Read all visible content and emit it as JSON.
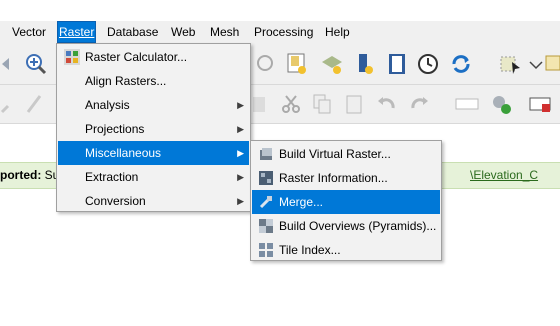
{
  "menubar": {
    "items": [
      {
        "label": "Vector"
      },
      {
        "label": "Raster"
      },
      {
        "label": "Database"
      },
      {
        "label": "Web"
      },
      {
        "label": "Mesh"
      },
      {
        "label": "Processing"
      },
      {
        "label": "Help"
      }
    ]
  },
  "raster_menu": {
    "items": [
      {
        "label": "Raster Calculator...",
        "icon": "raster-calculator-icon"
      },
      {
        "label": "Align Rasters..."
      },
      {
        "label": "Analysis",
        "submenu": true
      },
      {
        "label": "Projections",
        "submenu": true
      },
      {
        "label": "Miscellaneous",
        "submenu": true,
        "highlighted": true
      },
      {
        "label": "Extraction",
        "submenu": true
      },
      {
        "label": "Conversion",
        "submenu": true
      }
    ]
  },
  "misc_menu": {
    "items": [
      {
        "label": "Build Virtual Raster...",
        "icon": "virtual-raster-icon"
      },
      {
        "label": "Raster Information...",
        "icon": "raster-info-icon"
      },
      {
        "label": "Merge...",
        "icon": "merge-icon",
        "highlighted": true
      },
      {
        "label": "Build Overviews (Pyramids)...",
        "icon": "overviews-icon"
      },
      {
        "label": "Tile Index...",
        "icon": "tile-index-icon"
      }
    ]
  },
  "message_bar": {
    "text_bold": "ported:",
    "text_rest": " Su",
    "link": "\\Elevation_C"
  },
  "colors": {
    "menu_highlight": "#0078d7",
    "message_bar_bg": "#e6f2d9"
  }
}
